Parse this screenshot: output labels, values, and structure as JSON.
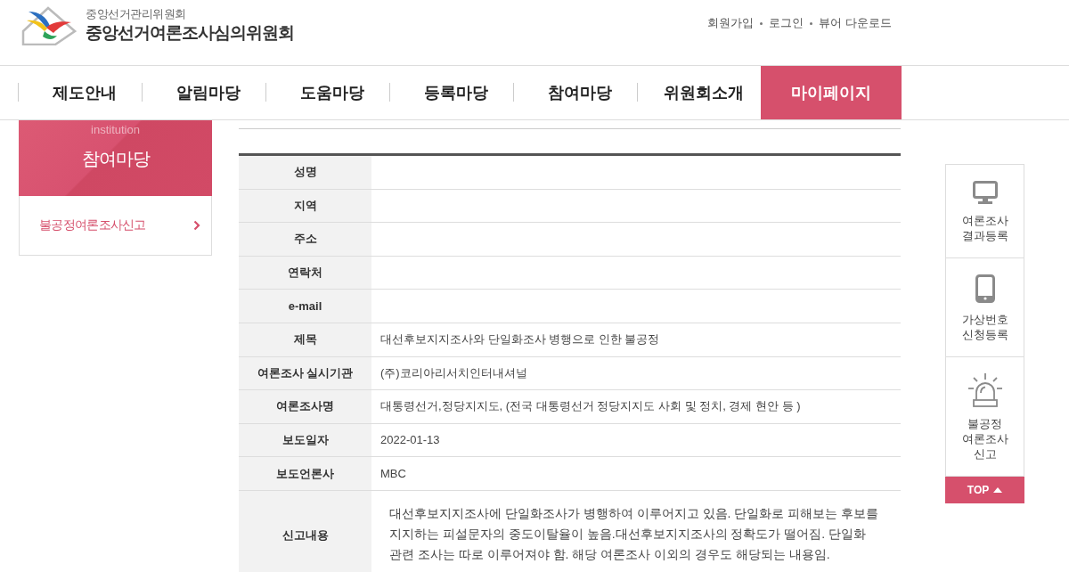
{
  "header": {
    "org_name": "중앙선거관리위원회",
    "site_name": "중앙선거여론조사심의위원회",
    "utility_links": [
      "회원가입",
      "로그인",
      "뷰어 다운로드"
    ]
  },
  "nav": [
    {
      "label": "제도안내",
      "selected": false
    },
    {
      "label": "알림마당",
      "selected": false
    },
    {
      "label": "도움마당",
      "selected": false
    },
    {
      "label": "등록마당",
      "selected": false
    },
    {
      "label": "참여마당",
      "selected": false
    },
    {
      "label": "위원회소개",
      "selected": false
    },
    {
      "label": "마이페이지",
      "selected": true
    }
  ],
  "sidebar": {
    "subtitle": "institution",
    "title": "참여마당",
    "items": [
      {
        "label": "불공정여론조사신고",
        "selected": true
      }
    ]
  },
  "table": {
    "rows": [
      {
        "kind": "text",
        "label": "성명"
      },
      {
        "kind": "text",
        "label": "지역"
      },
      {
        "kind": "text",
        "label": "주소"
      },
      {
        "kind": "text",
        "label": "연락처"
      },
      {
        "kind": "text",
        "label": "e-mail"
      },
      {
        "kind": "text",
        "label": "제목",
        "value": "대선후보지지조사와 단일화조사 병행으로 인한 불공정"
      },
      {
        "kind": "text",
        "label": "여론조사 실시기관",
        "value": "(주)코리아리서치인터내셔널"
      },
      {
        "kind": "text",
        "label": "여론조사명",
        "value": "대통령선거,정당지지도, (전국 대통령선거 정당지지도 사회 및 정치, 경제 현안 등 )"
      },
      {
        "kind": "text",
        "label": "보도일자",
        "value": "2022-01-13"
      },
      {
        "kind": "text",
        "label": "보도언론사",
        "value": "MBC"
      },
      {
        "kind": "long_text",
        "label": "신고내용",
        "value": "대선후보지지조사에 단일화조사가 병행하여 이루어지고 있음. 단일화로 피해보는 후보를 지지하는 피설문자의 중도이탈율이 높음.대선후보지지조사의 정확도가 떨어짐. 단일화 관련 조사는 따로 이루어져야 함. 해당 여론조사 이외의 경우도 해당되는 내용임."
      }
    ]
  },
  "quick_menu": {
    "items": [
      {
        "kind": "monitor",
        "label": "여론조사 결과등록"
      },
      {
        "kind": "phone",
        "label": "가상번호 신청등록"
      },
      {
        "kind": "siren",
        "label": "불공정 여론조사 신고"
      }
    ],
    "top_button": "TOP"
  }
}
